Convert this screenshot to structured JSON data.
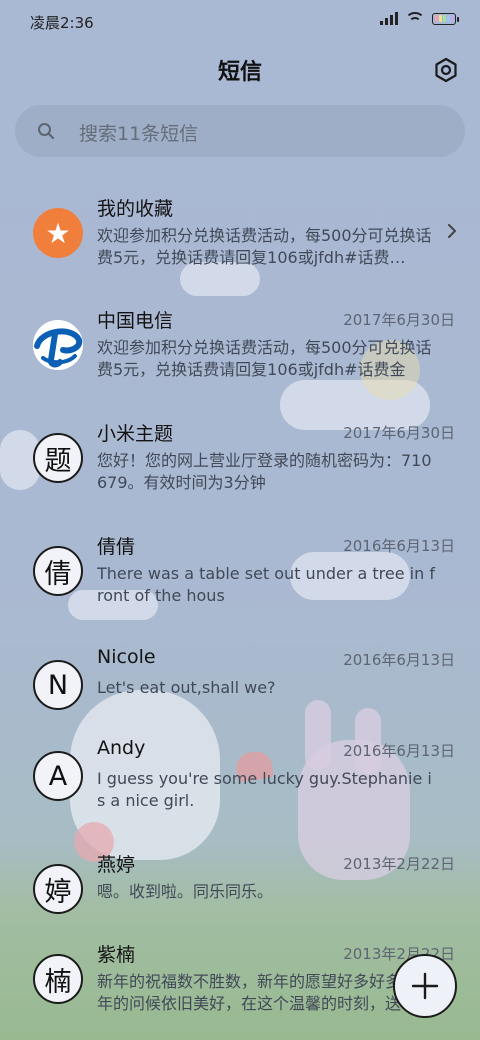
{
  "status_bar": {
    "time": "凌晨2:36"
  },
  "header": {
    "title": "短信",
    "settings_icon": "settings-icon"
  },
  "search": {
    "placeholder": "搜索11条短信"
  },
  "conversations": [
    {
      "name": "我的收藏",
      "date": "",
      "avatar": "star-icon",
      "preview": "欢迎参加积分兑换话费活动，每500分可兑换话费5元，兑换话费请回复106或jfdh#话费…",
      "has_chevron": true
    },
    {
      "name": "中国电信",
      "date": "2017年6月30日",
      "avatar": "china-telecom-logo",
      "preview": "欢迎参加积分兑换话费活动，每500分可兑换话费5元，兑换话费请回复106或jfdh#话费金额…"
    },
    {
      "name": "小米主题",
      "date": "2017年6月30日",
      "avatar": "题",
      "preview": "您好！您的网上营业厅登录的随机密码为：710679。有效时间为3分钟"
    },
    {
      "name": "倩倩",
      "date": "2016年6月13日",
      "avatar": "倩",
      "preview": "There was a table set out under a tree in front of the hous"
    },
    {
      "name": "Nicole",
      "date": "2016年6月13日",
      "avatar": "N",
      "preview": "Let's eat out,shall we?"
    },
    {
      "name": "Andy",
      "date": "2016年6月13日",
      "avatar": "A",
      "preview": "I guess you're some lucky guy.Stephanie is a nice girl."
    },
    {
      "name": "燕婷",
      "date": "2013年2月22日",
      "avatar": "婷",
      "preview": "嗯。收到啦。同乐同乐。"
    },
    {
      "name": "紫楠",
      "date": "2013年2月22日",
      "avatar": "楠",
      "preview": "新年的祝福数不胜数，新年的愿望好多好多，新年的问候依旧美好，在这个温馨的时刻，送…"
    }
  ],
  "fab": {
    "icon": "plus-icon"
  },
  "colors": {
    "accent_star": "#f17f3c",
    "telecom_blue": "#0b5fb5"
  }
}
